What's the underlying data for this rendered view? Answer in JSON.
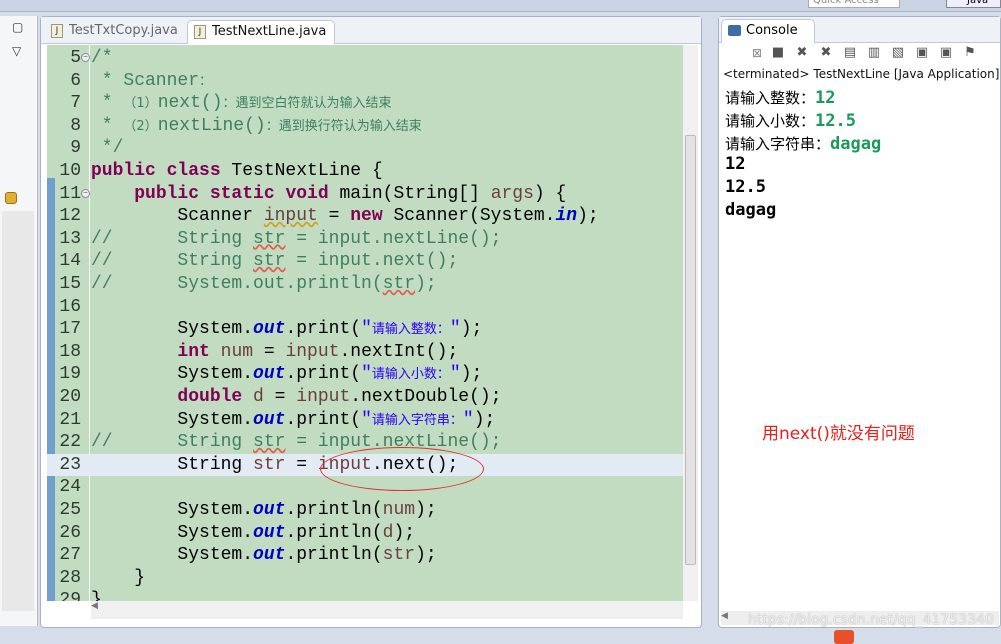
{
  "toolbar": {
    "quick_access_placeholder": "Quick Access",
    "perspective": "Java"
  },
  "editor": {
    "tabs": [
      {
        "label": "TestTxtCopy.java",
        "active": false
      },
      {
        "label": "TestNextLine.java",
        "active": true,
        "close": "⊠"
      }
    ],
    "highlighted_line": 23,
    "lines": [
      {
        "n": "5",
        "fold": true,
        "t": [
          [
            "/*",
            "cm"
          ]
        ]
      },
      {
        "n": "6",
        "t": [
          [
            " * Scanner",
            "cm"
          ],
          [
            "：",
            "cmzh"
          ]
        ]
      },
      {
        "n": "7",
        "t": [
          [
            " * ",
            "cm"
          ],
          [
            "（1）",
            "cmzh"
          ],
          [
            "next()",
            "cm"
          ],
          [
            "：遇到空白符就认为输入结束",
            "cmzh"
          ]
        ]
      },
      {
        "n": "8",
        "t": [
          [
            " * ",
            "cm"
          ],
          [
            "（2）",
            "cmzh"
          ],
          [
            "nextLine()",
            "cm"
          ],
          [
            "：遇到换行符认为输入结束",
            "cmzh"
          ]
        ]
      },
      {
        "n": "9",
        "t": [
          [
            " */",
            "cm"
          ]
        ]
      },
      {
        "n": "10",
        "t": [
          [
            "public class",
            "kw"
          ],
          [
            " TestNextLine {",
            "nm"
          ]
        ]
      },
      {
        "n": "11",
        "fold": true,
        "t": [
          [
            "    ",
            "nm"
          ],
          [
            "public static void",
            "kw"
          ],
          [
            " main(String[] ",
            "nm"
          ],
          [
            "args",
            "lv"
          ],
          [
            ") {",
            "nm"
          ]
        ]
      },
      {
        "n": "12",
        "warn": true,
        "t": [
          [
            "        Scanner ",
            "nm"
          ],
          [
            "input",
            "lv warn"
          ],
          [
            " = ",
            "nm"
          ],
          [
            "new",
            "kw"
          ],
          [
            " Scanner(System.",
            "nm"
          ],
          [
            "in",
            "fd"
          ],
          [
            ");",
            "nm"
          ]
        ]
      },
      {
        "n": "13",
        "t": [
          [
            "//      String ",
            "cm"
          ],
          [
            "str",
            "cm err"
          ],
          [
            " = input.nextLine();",
            "cm"
          ]
        ]
      },
      {
        "n": "14",
        "t": [
          [
            "//      String ",
            "cm"
          ],
          [
            "str",
            "cm err"
          ],
          [
            " = input.next();",
            "cm"
          ]
        ]
      },
      {
        "n": "15",
        "t": [
          [
            "//      System.out.println(",
            "cm"
          ],
          [
            "str",
            "cm err"
          ],
          [
            ");",
            "cm"
          ]
        ]
      },
      {
        "n": "16",
        "t": []
      },
      {
        "n": "17",
        "t": [
          [
            "        System.",
            "nm"
          ],
          [
            "out",
            "fd"
          ],
          [
            ".print(",
            "nm"
          ],
          [
            "\"",
            "st"
          ],
          [
            "请输入整数：",
            "stzh"
          ],
          [
            "\"",
            "st"
          ],
          [
            ");",
            "nm"
          ]
        ]
      },
      {
        "n": "18",
        "t": [
          [
            "        ",
            "nm"
          ],
          [
            "int",
            "kw"
          ],
          [
            " ",
            "nm"
          ],
          [
            "num",
            "lv"
          ],
          [
            " = ",
            "nm"
          ],
          [
            "input",
            "lv"
          ],
          [
            ".nextInt();",
            "nm"
          ]
        ]
      },
      {
        "n": "19",
        "t": [
          [
            "        System.",
            "nm"
          ],
          [
            "out",
            "fd"
          ],
          [
            ".print(",
            "nm"
          ],
          [
            "\"",
            "st"
          ],
          [
            "请输入小数：",
            "stzh"
          ],
          [
            "\"",
            "st"
          ],
          [
            ");",
            "nm"
          ]
        ]
      },
      {
        "n": "20",
        "t": [
          [
            "        ",
            "nm"
          ],
          [
            "double",
            "kw"
          ],
          [
            " ",
            "nm"
          ],
          [
            "d",
            "lv"
          ],
          [
            " = ",
            "nm"
          ],
          [
            "input",
            "lv"
          ],
          [
            ".nextDouble();",
            "nm"
          ]
        ]
      },
      {
        "n": "21",
        "t": [
          [
            "        System.",
            "nm"
          ],
          [
            "out",
            "fd"
          ],
          [
            ".print(",
            "nm"
          ],
          [
            "\"",
            "st"
          ],
          [
            "请输入字符串：",
            "stzh"
          ],
          [
            "\"",
            "st"
          ],
          [
            ");",
            "nm"
          ]
        ]
      },
      {
        "n": "22",
        "t": [
          [
            "//      String ",
            "cm"
          ],
          [
            "str",
            "cm err"
          ],
          [
            " = input.nextLine();",
            "cm"
          ]
        ]
      },
      {
        "n": "23",
        "t": [
          [
            "        String ",
            "nm"
          ],
          [
            "str",
            "lv"
          ],
          [
            " = ",
            "nm"
          ],
          [
            "input",
            "lv"
          ],
          [
            ".next();",
            "nm"
          ]
        ]
      },
      {
        "n": "24",
        "t": []
      },
      {
        "n": "25",
        "t": [
          [
            "        System.",
            "nm"
          ],
          [
            "out",
            "fd"
          ],
          [
            ".println(",
            "nm"
          ],
          [
            "num",
            "lv"
          ],
          [
            ");",
            "nm"
          ]
        ]
      },
      {
        "n": "26",
        "t": [
          [
            "        System.",
            "nm"
          ],
          [
            "out",
            "fd"
          ],
          [
            ".println(",
            "nm"
          ],
          [
            "d",
            "lv"
          ],
          [
            ");",
            "nm"
          ]
        ]
      },
      {
        "n": "27",
        "t": [
          [
            "        System.",
            "nm"
          ],
          [
            "out",
            "fd"
          ],
          [
            ".println(",
            "nm"
          ],
          [
            "str",
            "lv"
          ],
          [
            ");",
            "nm"
          ]
        ]
      },
      {
        "n": "28",
        "t": [
          [
            "    }",
            "nm"
          ]
        ]
      },
      {
        "n": "29",
        "t": [
          [
            "}",
            "nm"
          ]
        ]
      }
    ]
  },
  "console": {
    "tab_label": "Console",
    "close": "⊠",
    "status": "<terminated> TestNextLine [Java Application] D:\\",
    "prompts": [
      {
        "label": "请输入整数：",
        "input": "12"
      },
      {
        "label": "请输入小数：",
        "input": "12.5"
      },
      {
        "label": "请输入字符串：",
        "input": "dagag"
      }
    ],
    "output": [
      "12",
      "12.5",
      "dagag"
    ]
  },
  "annotation": "用next()就没有问题",
  "watermark": "https://blog.csdn.net/qq_41753340",
  "colors": {
    "keyword": "#7f0055",
    "comment": "#3f7f5f",
    "string": "#2a00ff",
    "field": "#0000c0",
    "editor_bg": "#c2dcc2",
    "annotation": "#e8201a",
    "console_input": "#1a9a5a"
  }
}
